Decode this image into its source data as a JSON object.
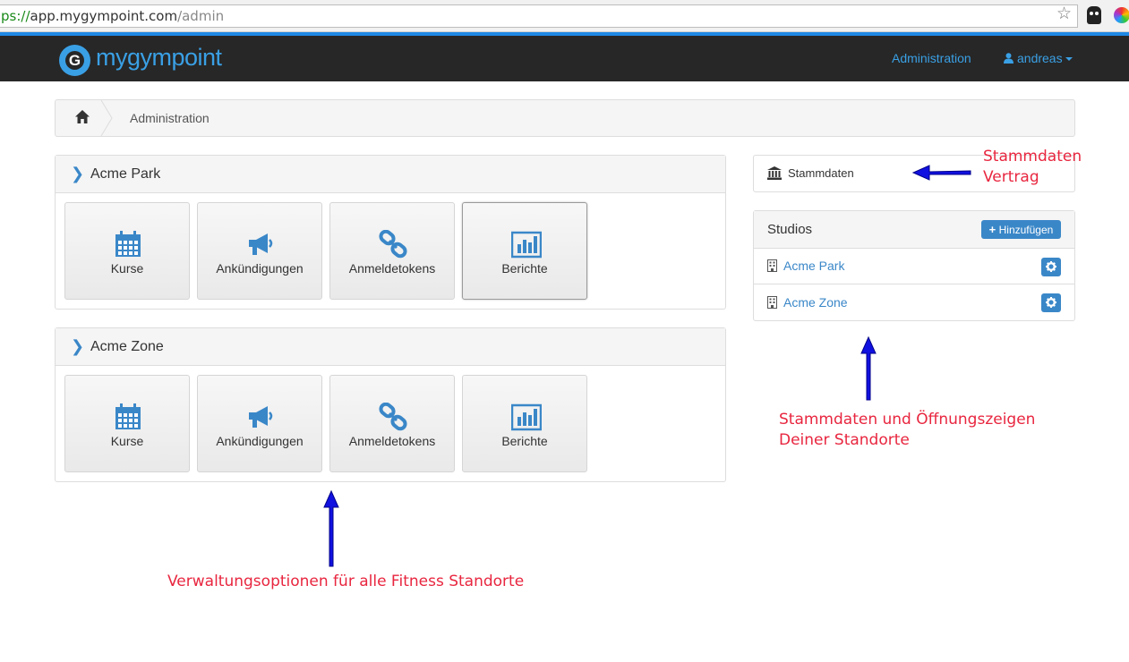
{
  "browser": {
    "url_scheme": "ps://",
    "url_host": "app.mygympoint.com",
    "url_path": "/admin"
  },
  "navbar": {
    "logo_text": "mygympoint",
    "admin_link": "Administration",
    "user_name": "andreas"
  },
  "breadcrumb": {
    "current": "Administration"
  },
  "studios_panels": [
    {
      "name": "Acme Park",
      "tiles": [
        "Kurse",
        "Ankündigungen",
        "Anmeldetokens",
        "Berichte"
      ]
    },
    {
      "name": "Acme Zone",
      "tiles": [
        "Kurse",
        "Ankündigungen",
        "Anmeldetokens",
        "Berichte"
      ]
    }
  ],
  "sidebar": {
    "stammdaten_label": "Stammdaten",
    "studios_title": "Studios",
    "add_button": "Hinzufügen",
    "studios": [
      "Acme Park",
      "Acme Zone"
    ]
  },
  "annotations": {
    "stammdaten_line1": "Stammdaten",
    "stammdaten_line2": "Vertrag",
    "studios_line1": "Stammdaten und Öffnungszeigen",
    "studios_line2": "Deiner Standorte",
    "options": "Verwaltungsoptionen für alle Fitness Standorte"
  },
  "colors": {
    "accent": "#3a87c8",
    "navbar": "#272727",
    "annotation_text": "#e8263f",
    "annotation_arrow": "#0000ff"
  }
}
